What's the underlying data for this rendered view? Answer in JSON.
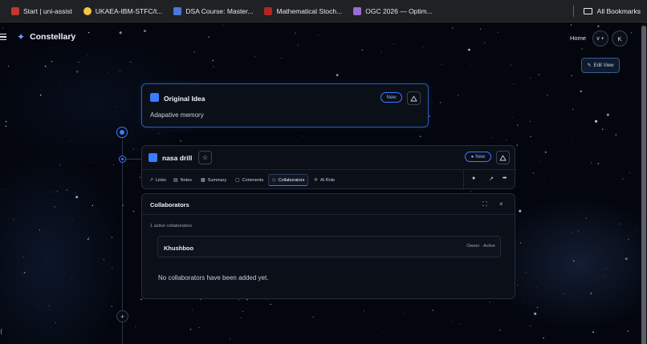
{
  "bookmarks": {
    "items": [
      {
        "label": "Start | uni-assist",
        "color": "#c0392b"
      },
      {
        "label": "UKAEA-IBM-STFC/t...",
        "color": "#f4c542"
      },
      {
        "label": "DSA Course: Master...",
        "color": "#4a78d6"
      },
      {
        "label": "Mathematical Stoch...",
        "color": "#b3261e"
      },
      {
        "label": "OGC 2026 — Optim...",
        "color": "#9b6cd6"
      }
    ],
    "all_bookmarks": "All Bookmarks"
  },
  "header": {
    "brand": "Constellary",
    "nav_home": "Home",
    "version_btn": "v +",
    "avatar_initial": "K",
    "edit_view": "Edit View"
  },
  "idea_card": {
    "title": "Original Idea",
    "badge": "New",
    "description": "Adapative memory"
  },
  "node_card": {
    "title": "nasa drill",
    "badge": "New",
    "tabs": [
      {
        "label": "Links",
        "icon": "link-icon"
      },
      {
        "label": "Notes",
        "icon": "notes-icon"
      },
      {
        "label": "Summary",
        "icon": "summary-icon"
      },
      {
        "label": "Comments",
        "icon": "comments-icon"
      },
      {
        "label": "Collaborators",
        "icon": "collaborators-icon"
      },
      {
        "label": "AI Role",
        "icon": "ai-role-icon"
      }
    ],
    "active_tab": "Collaborators"
  },
  "collaborators_panel": {
    "title": "Collaborators",
    "active_count": "1 active collaborators",
    "collaborators": [
      {
        "name": "Khushboo",
        "status": "Owner · Active"
      }
    ],
    "empty_message": "No collaborators have been added yet."
  },
  "colors": {
    "accent": "#3c7bff",
    "background": "#03060d",
    "card": "#0b0f18"
  }
}
